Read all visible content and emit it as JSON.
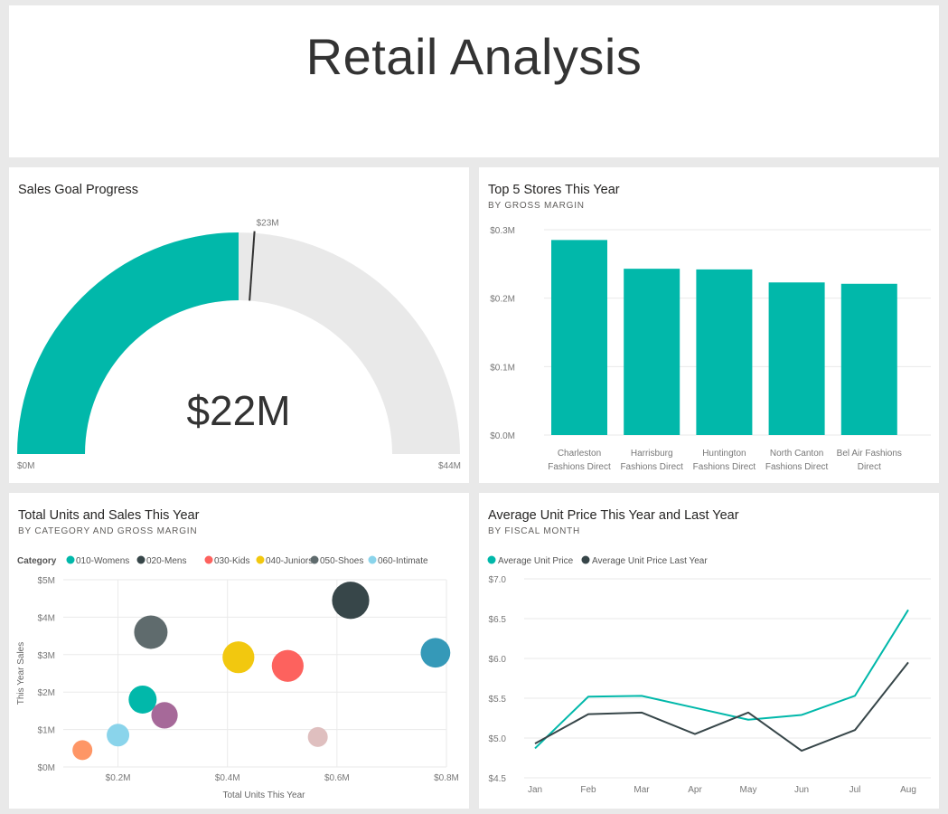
{
  "header": {
    "title": "Retail Analysis"
  },
  "tiles": {
    "gauge": {
      "title": "Sales Goal Progress",
      "value_label": "$22M",
      "min_label": "$0M",
      "max_label": "$44M",
      "target_label": "$23M",
      "value": 22,
      "min": 0,
      "max": 44,
      "target": 23,
      "fill_color": "#01b8aa",
      "track_color": "#e9e9e9"
    },
    "stores": {
      "title": "Top 5 Stores This Year",
      "subtitle": "BY GROSS MARGIN"
    },
    "scatter": {
      "title": "Total Units and Sales This Year",
      "subtitle": "BY CATEGORY AND GROSS MARGIN"
    },
    "price": {
      "title": "Average Unit Price This Year and Last Year",
      "subtitle": "BY FISCAL MONTH"
    }
  },
  "chart_data": [
    {
      "type": "bar",
      "id": "stores",
      "categories": [
        [
          "Charleston",
          "Fashions Direct"
        ],
        [
          "Harrisburg",
          "Fashions Direct"
        ],
        [
          "Huntington",
          "Fashions Direct"
        ],
        [
          "North Canton",
          "Fashions Direct"
        ],
        [
          "Bel Air Fashions",
          "Direct"
        ]
      ],
      "values": [
        0.285,
        0.243,
        0.242,
        0.223,
        0.221
      ],
      "ylim": [
        0,
        0.3
      ],
      "yticks": [
        0,
        0.1,
        0.2,
        0.3
      ],
      "ytick_labels": [
        "$0.0M",
        "$0.1M",
        "$0.2M",
        "$0.3M"
      ],
      "color": "#01b8aa",
      "grid": true
    },
    {
      "type": "scatter",
      "id": "units",
      "legend_title": "Category",
      "xlabel": "Total Units This Year",
      "ylabel": "This Year Sales",
      "xlim": [
        0.1,
        0.8
      ],
      "ylim": [
        0,
        5
      ],
      "xticks": [
        0.2,
        0.4,
        0.6,
        0.8
      ],
      "xtick_labels": [
        "$0.2M",
        "$0.4M",
        "$0.6M",
        "$0.8M"
      ],
      "yticks": [
        0,
        1,
        2,
        3,
        4,
        5
      ],
      "ytick_labels": [
        "$0M",
        "$1M",
        "$2M",
        "$3M",
        "$4M",
        "$5M"
      ],
      "legend": [
        {
          "name": "010-Womens",
          "color": "#01b8aa"
        },
        {
          "name": "020-Mens",
          "color": "#374649"
        },
        {
          "name": "030-Kids",
          "color": "#fd625e"
        },
        {
          "name": "040-Juniors",
          "color": "#f2c80f"
        },
        {
          "name": "050-Shoes",
          "color": "#5f6b6d"
        },
        {
          "name": "060-Intimate",
          "color": "#8ad4eb"
        }
      ],
      "points": [
        {
          "x": 0.135,
          "y": 0.45,
          "size": 0.2,
          "color": "#fe9666"
        },
        {
          "x": 0.2,
          "y": 0.85,
          "size": 0.25,
          "color": "#8ad4eb"
        },
        {
          "x": 0.245,
          "y": 1.8,
          "size": 0.35,
          "color": "#01b8aa"
        },
        {
          "x": 0.26,
          "y": 3.6,
          "size": 0.45,
          "color": "#5f6b6d"
        },
        {
          "x": 0.285,
          "y": 1.38,
          "size": 0.32,
          "color": "#a66999"
        },
        {
          "x": 0.42,
          "y": 2.93,
          "size": 0.42,
          "color": "#f2c80f"
        },
        {
          "x": 0.51,
          "y": 2.7,
          "size": 0.42,
          "color": "#fd625e"
        },
        {
          "x": 0.565,
          "y": 0.8,
          "size": 0.2,
          "color": "#dfbfbf"
        },
        {
          "x": 0.625,
          "y": 4.45,
          "size": 0.52,
          "color": "#374649"
        },
        {
          "x": 0.78,
          "y": 3.05,
          "size": 0.38,
          "color": "#3599b8"
        }
      ]
    },
    {
      "type": "line",
      "id": "price",
      "x": [
        "Jan",
        "Feb",
        "Mar",
        "Apr",
        "May",
        "Jun",
        "Jul",
        "Aug"
      ],
      "ylim": [
        4.5,
        7.0
      ],
      "yticks": [
        4.5,
        5.0,
        5.5,
        6.0,
        6.5,
        7.0
      ],
      "ytick_labels": [
        "$4.5",
        "$5.0",
        "$5.5",
        "$6.0",
        "$6.5",
        "$7.0"
      ],
      "series": [
        {
          "name": "Average Unit Price",
          "color": "#01b8aa",
          "values": [
            4.87,
            5.52,
            5.53,
            5.38,
            5.23,
            5.29,
            5.53,
            6.61
          ]
        },
        {
          "name": "Average Unit Price Last Year",
          "color": "#374649",
          "values": [
            4.93,
            5.3,
            5.32,
            5.05,
            5.32,
            4.84,
            5.1,
            5.95
          ]
        }
      ],
      "grid": true
    }
  ]
}
